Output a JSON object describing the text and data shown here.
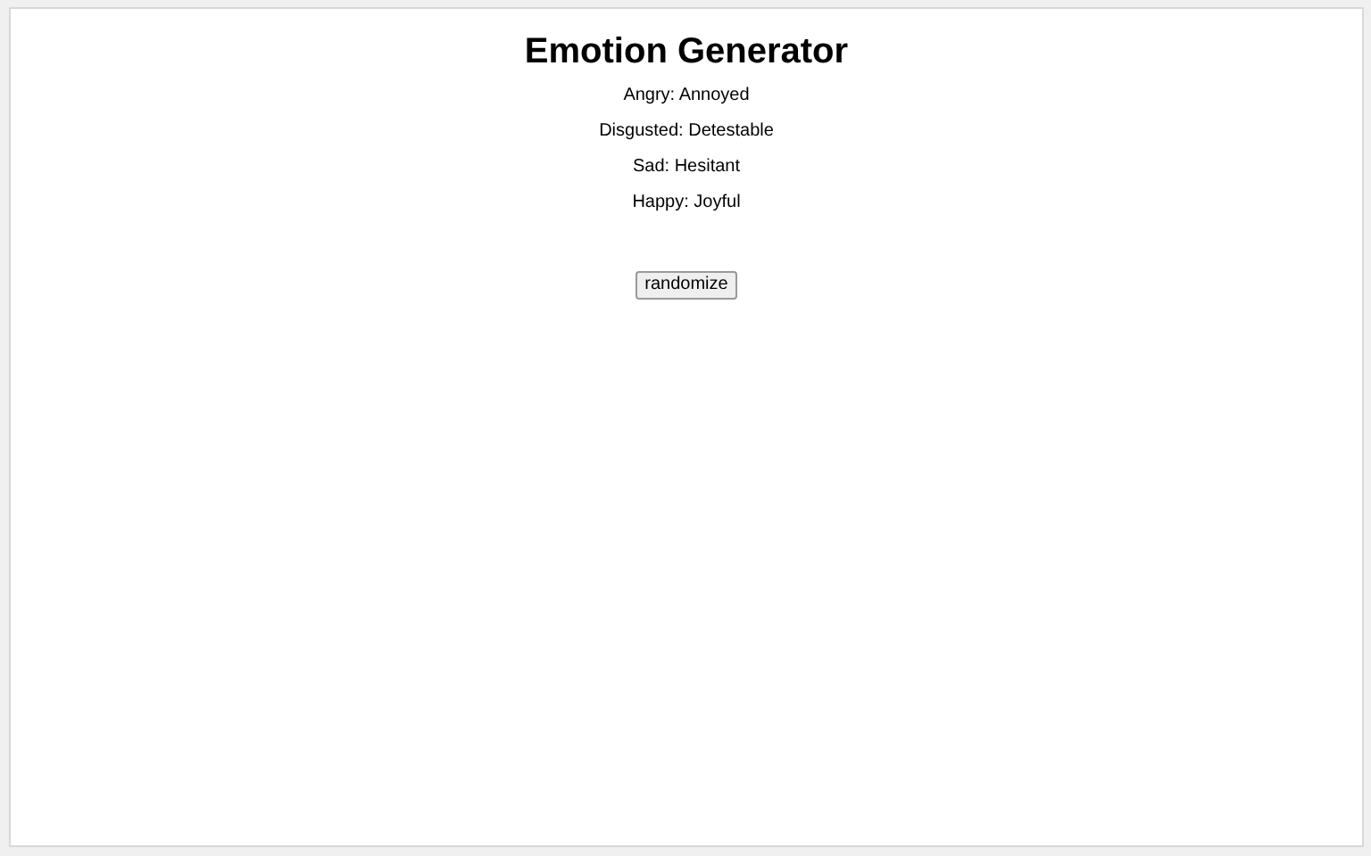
{
  "title": "Emotion Generator",
  "emotions": [
    "Angry: Annoyed",
    "Disgusted: Detestable",
    "Sad: Hesitant",
    "Happy: Joyful"
  ],
  "button": "randomize"
}
